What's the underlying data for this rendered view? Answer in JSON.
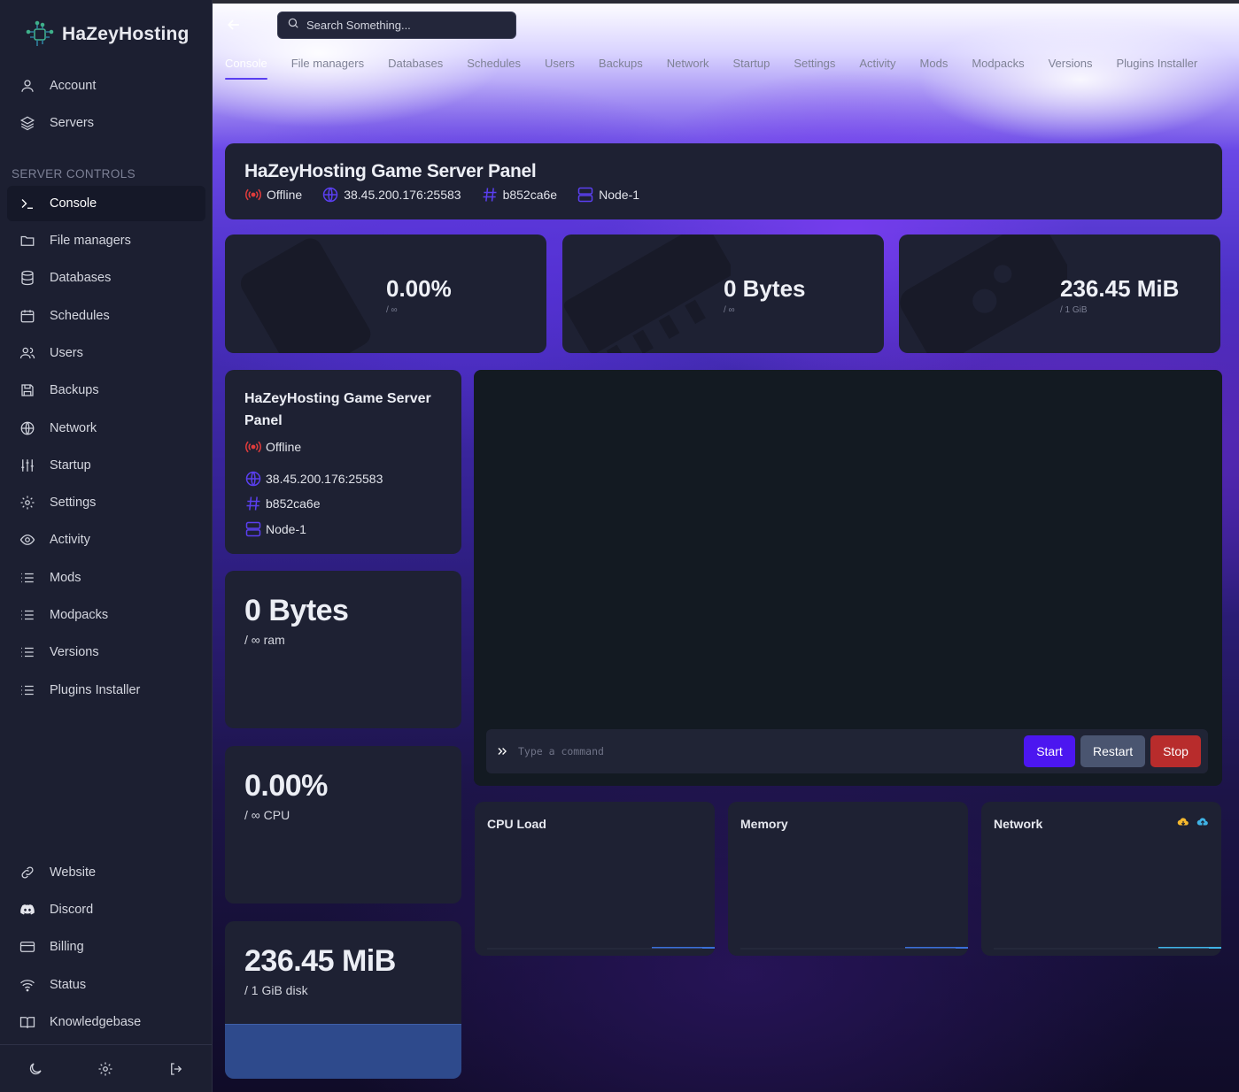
{
  "brand": {
    "name": "HaZeyHosting"
  },
  "sidebar": {
    "top_items": [
      {
        "label": "Account",
        "icon": "user-icon"
      },
      {
        "label": "Servers",
        "icon": "layers-icon"
      }
    ],
    "section_label": "SERVER CONTROLS",
    "controls": [
      {
        "label": "Console",
        "icon": "terminal-icon",
        "active": true
      },
      {
        "label": "File managers",
        "icon": "folder-icon"
      },
      {
        "label": "Databases",
        "icon": "database-icon"
      },
      {
        "label": "Schedules",
        "icon": "calendar-icon"
      },
      {
        "label": "Users",
        "icon": "users-icon"
      },
      {
        "label": "Backups",
        "icon": "save-icon"
      },
      {
        "label": "Network",
        "icon": "globe-icon"
      },
      {
        "label": "Startup",
        "icon": "sliders-icon"
      },
      {
        "label": "Settings",
        "icon": "gear-icon"
      },
      {
        "label": "Activity",
        "icon": "eye-icon"
      },
      {
        "label": "Mods",
        "icon": "list-icon"
      },
      {
        "label": "Modpacks",
        "icon": "list-icon"
      },
      {
        "label": "Versions",
        "icon": "list-icon"
      },
      {
        "label": "Plugins Installer",
        "icon": "list-icon"
      }
    ],
    "bottom_items": [
      {
        "label": "Website",
        "icon": "link-icon"
      },
      {
        "label": "Discord",
        "icon": "discord-icon"
      },
      {
        "label": "Billing",
        "icon": "credit-card-icon"
      },
      {
        "label": "Status",
        "icon": "wifi-icon"
      },
      {
        "label": "Knowledgebase",
        "icon": "book-icon"
      }
    ]
  },
  "search": {
    "placeholder": "Search Something..."
  },
  "tabs": [
    "Console",
    "File managers",
    "Databases",
    "Schedules",
    "Users",
    "Backups",
    "Network",
    "Startup",
    "Settings",
    "Activity",
    "Mods",
    "Modpacks",
    "Versions",
    "Plugins Installer"
  ],
  "server": {
    "title": "HaZeyHosting Game Server Panel",
    "status": "Offline",
    "address": "38.45.200.176:25583",
    "id": "b852ca6e",
    "node": "Node-1"
  },
  "stats": [
    {
      "value": "0.00%",
      "sub": "/ ∞",
      "icon": "cpu-icon"
    },
    {
      "value": "0 Bytes",
      "sub": "/ ∞",
      "icon": "memory-icon"
    },
    {
      "value": "236.45 MiB",
      "sub": "/ 1 GiB",
      "icon": "disk-icon"
    }
  ],
  "big_stats": {
    "ram": {
      "value": "0 Bytes",
      "sub": "/ ∞ ram"
    },
    "cpu": {
      "value": "0.00%",
      "sub": "/ ∞ CPU"
    },
    "disk": {
      "value": "236.45 MiB",
      "sub": "/ 1 GiB disk",
      "fill_fraction": 0.35
    }
  },
  "console": {
    "placeholder": "Type a command",
    "start": "Start",
    "restart": "Restart",
    "stop": "Stop"
  },
  "graphs": {
    "cpu": "CPU Load",
    "memory": "Memory",
    "network": "Network"
  },
  "colors": {
    "accent": "#4c16f0",
    "offline": "#e03c3c",
    "start": "#4c16f0",
    "restart": "#4a5570",
    "stop": "#b82c2c",
    "disk_fill": "#2e4a8c"
  }
}
